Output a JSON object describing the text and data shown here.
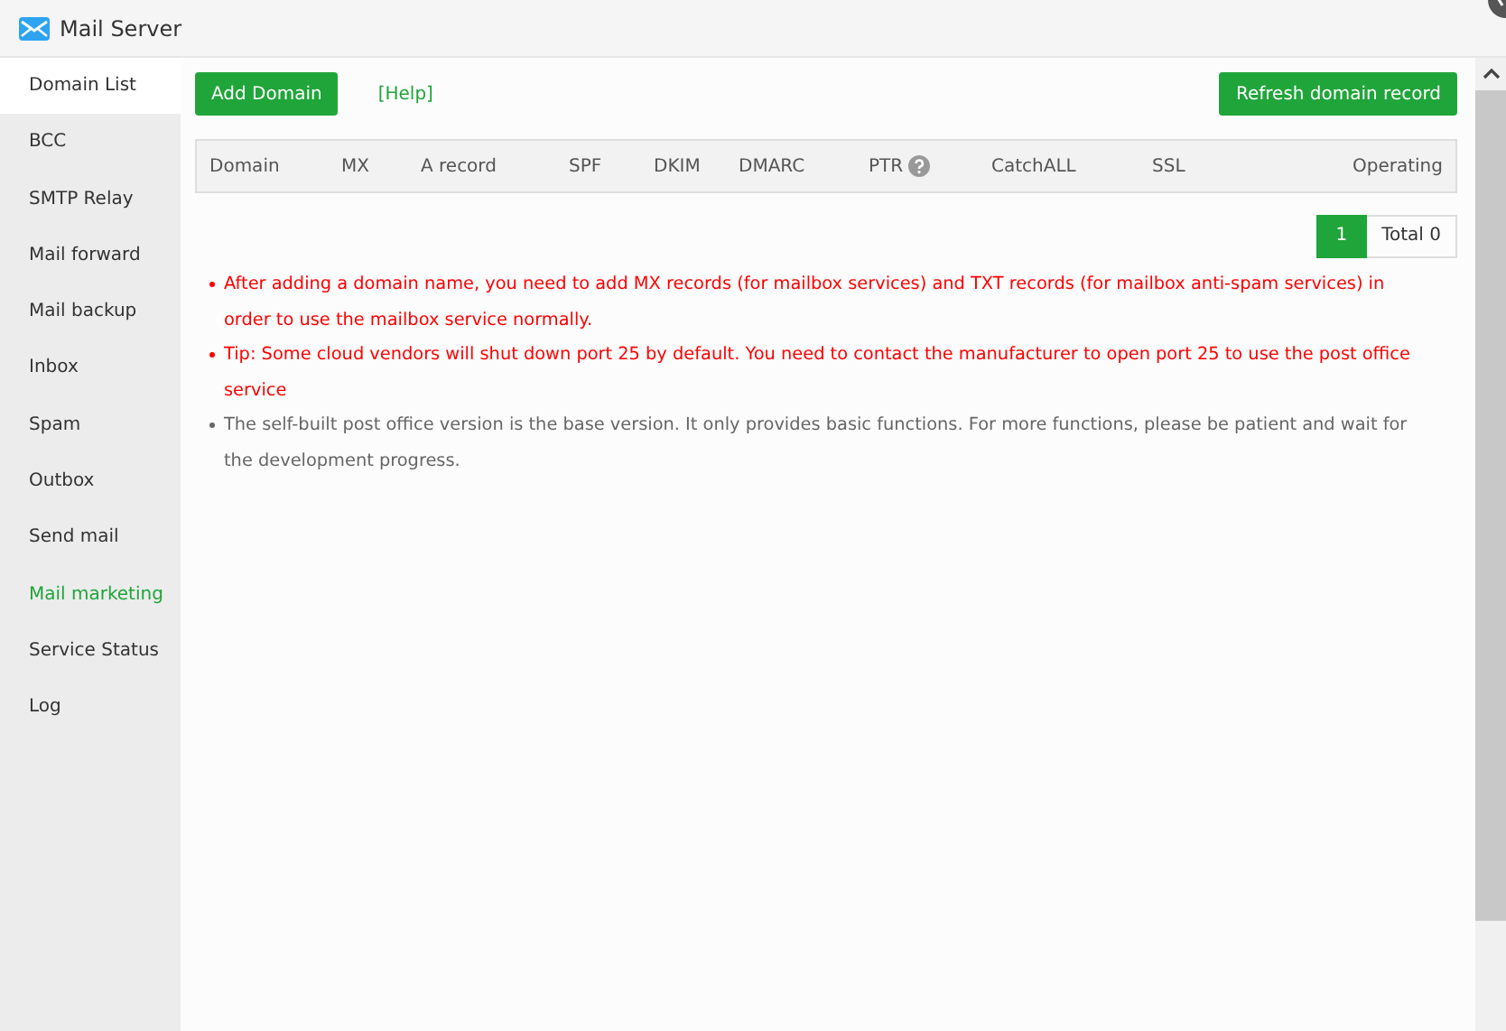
{
  "window": {
    "title": "Mail Server"
  },
  "sidebar": {
    "items": [
      {
        "label": "Domain List",
        "selected": true,
        "highlighted": false
      },
      {
        "label": "BCC",
        "selected": false,
        "highlighted": false
      },
      {
        "label": "SMTP Relay",
        "selected": false,
        "highlighted": false
      },
      {
        "label": "Mail forward",
        "selected": false,
        "highlighted": false
      },
      {
        "label": "Mail backup",
        "selected": false,
        "highlighted": false
      },
      {
        "label": "Inbox",
        "selected": false,
        "highlighted": false
      },
      {
        "label": "Spam",
        "selected": false,
        "highlighted": false
      },
      {
        "label": "Outbox",
        "selected": false,
        "highlighted": false
      },
      {
        "label": "Send mail",
        "selected": false,
        "highlighted": false
      },
      {
        "label": "Mail marketing",
        "selected": false,
        "highlighted": true
      },
      {
        "label": "Service Status",
        "selected": false,
        "highlighted": false
      },
      {
        "label": "Log",
        "selected": false,
        "highlighted": false
      }
    ]
  },
  "toolbar": {
    "add_button": "Add Domain",
    "help_link": "[Help]",
    "refresh_button": "Refresh domain record"
  },
  "table": {
    "columns": [
      {
        "label": "Domain",
        "help": false
      },
      {
        "label": "MX",
        "help": false
      },
      {
        "label": "A record",
        "help": false
      },
      {
        "label": "SPF",
        "help": false
      },
      {
        "label": "DKIM",
        "help": false
      },
      {
        "label": "DMARC",
        "help": false
      },
      {
        "label": "PTR",
        "help": true
      },
      {
        "label": "CatchALL",
        "help": false
      },
      {
        "label": "SSL",
        "help": false
      },
      {
        "label": "Operating",
        "help": false
      }
    ]
  },
  "pagination": {
    "pages": [
      {
        "label": "1",
        "selected": true
      }
    ],
    "total": "Total 0"
  },
  "notes": [
    {
      "kind": "warning",
      "text": "After adding a domain name, you need to add MX records (for mailbox services) and TXT records (for mailbox anti-spam services) in order to use the mailbox service normally."
    },
    {
      "kind": "warning",
      "text": "Tip: Some cloud vendors will shut down port 25 by default. You need to contact the manufacturer to open port 25 to use the post office service"
    },
    {
      "kind": "info",
      "text": "The self-built post office version is the base version. It only provides basic functions. For more functions, please be patient and wait for the development progress."
    }
  ]
}
